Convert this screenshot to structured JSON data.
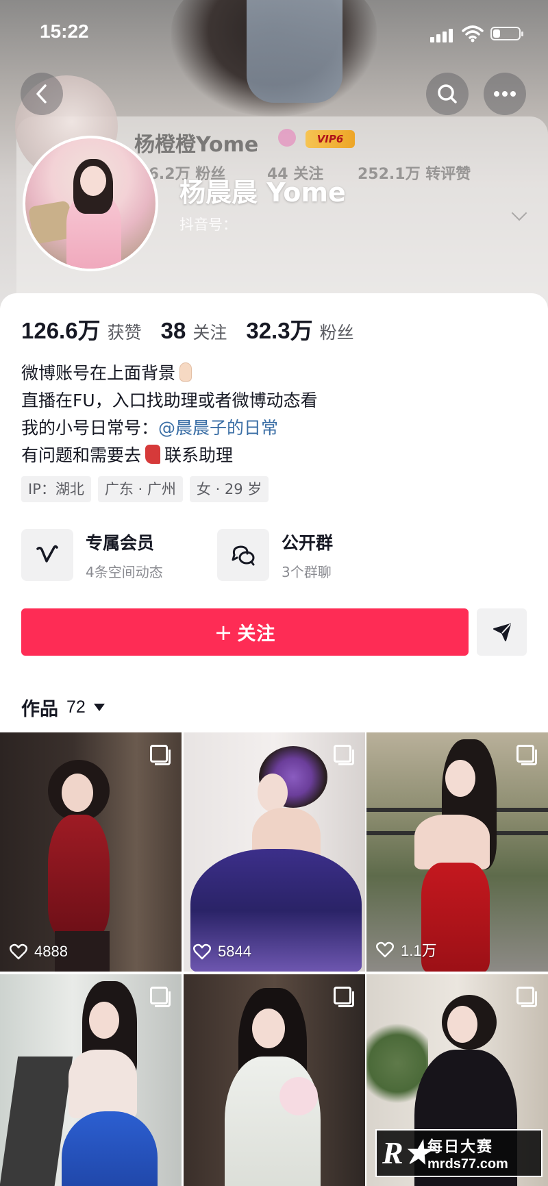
{
  "status_bar": {
    "time": "15:22"
  },
  "background_profile": {
    "name": "杨橙橙Yome",
    "vip_label": "VIP6",
    "stats_text": "126.2万 粉丝",
    "follow_text": "44 关注",
    "likes_text": "252.1万 转评赞"
  },
  "profile": {
    "display_name": "杨晨晨 Yome",
    "douyin_id_label": "抖音号：",
    "stats": [
      {
        "value": "126.6万",
        "label": "获赞"
      },
      {
        "value": "38",
        "label": "关注"
      },
      {
        "value": "32.3万",
        "label": "粉丝"
      }
    ],
    "bio": {
      "line1": "微博账号在上面背景",
      "line2": "直播在FU，入口找助理或者微博动态看",
      "line3_prefix": "我的小号日常号：",
      "line3_mention": "@晨晨子的日常",
      "line4_prefix": "有问题和需要去",
      "line4_suffix": "联系助理"
    },
    "tags": [
      "IP：湖北",
      "广东 · 广州",
      "女 · 29 岁"
    ]
  },
  "features": {
    "member": {
      "title": "专属会员",
      "subtitle": "4条空间动态",
      "icon": "v-member-icon"
    },
    "group": {
      "title": "公开群",
      "subtitle": "3个群聊",
      "icon": "chat-bubbles-icon"
    }
  },
  "actions": {
    "follow_label": "关注",
    "share_icon": "share-arrow-icon"
  },
  "works": {
    "label": "作品",
    "count": "72",
    "items": [
      {
        "likes": "4888",
        "multi": true
      },
      {
        "likes": "5844",
        "multi": true
      },
      {
        "likes": "1.1万",
        "multi": true
      },
      {
        "likes": "",
        "multi": true
      },
      {
        "likes": "",
        "multi": true
      },
      {
        "likes": "",
        "multi": true
      }
    ]
  },
  "watermark": {
    "cn": "每日大赛",
    "url": "mrds77.com"
  },
  "colors": {
    "accent": "#fe2c55",
    "mention": "#3a6ea5",
    "chip_bg": "#f1f1f2"
  }
}
